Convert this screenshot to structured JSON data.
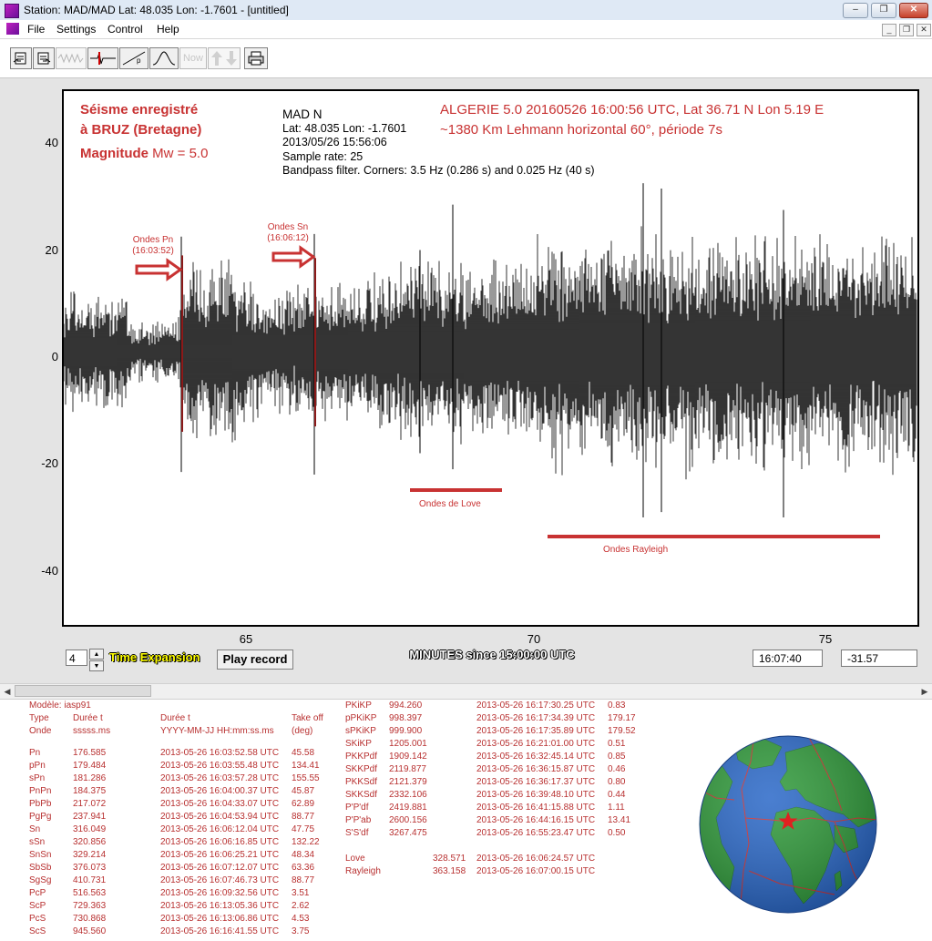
{
  "window": {
    "title": "Station: MAD/MAD Lat: 48.035 Lon: -1.7601 - [untitled]",
    "controls": [
      "–",
      "❐",
      "✕"
    ]
  },
  "menu": [
    "File",
    "Settings",
    "Control",
    "Help"
  ],
  "toolbar": {
    "icons": [
      "open-file-icon",
      "save-file-icon",
      "raw-trace-icon",
      "filter-trace-icon",
      "spectrum-icon",
      "distribution-icon",
      "now-icon",
      "up-down-arrows-icon",
      "print-icon"
    ],
    "now_label": "Now"
  },
  "plot": {
    "annotation_left": {
      "line1": "Séisme enregistré",
      "line2": "à BRUZ (Bretagne)",
      "line3_a": "Magnitude",
      "line3_b": "Mw = 5.0"
    },
    "info_block": {
      "station": "MAD  N",
      "latlon": "Lat: 48.035 Lon: -1.7601",
      "datetime": "2013/05/26 15:56:06",
      "sample_rate": "Sample rate: 25",
      "filter": "Bandpass filter. Corners: 3.5 Hz (0.286 s) and 0.025 Hz (40 s)"
    },
    "annotation_right": {
      "line1": "ALGERIE 5.0 20160526 16:00:56 UTC, Lat 36.71 N Lon 5.19 E",
      "line2": "~1380 Km Lehmann horizontal 60°, période 7s"
    },
    "markers": {
      "pn_label": "Ondes Pn",
      "pn_time": "(16:03:52)",
      "sn_label": "Ondes Sn",
      "sn_time": "(16:06:12)",
      "love_label": "Ondes de Love",
      "rayleigh_label": "Ondes Rayleigh"
    },
    "y_ticks": [
      "40",
      "20",
      "0",
      "-20",
      "-40"
    ],
    "x_ticks": [
      "65",
      "70",
      "75"
    ],
    "x_axis_title": "MINUTES since 15:00:00 UTC",
    "colors": {
      "trace": "#000000",
      "annotation_red": "#c83232",
      "pick_line": "#8b1a1a"
    }
  },
  "controls": {
    "time_expansion_value": "4",
    "time_expansion_label": "Time Expansion",
    "play_button": "Play record",
    "time_readout": "16:07:40",
    "value_readout": "-31.57"
  },
  "phases_left": {
    "model": "Modèle: iasp91",
    "header1": [
      "Type",
      "Durée t",
      "Durée t",
      "Take off"
    ],
    "header2": [
      "Onde",
      "sssss.ms",
      "YYYY-MM-JJ HH:mm:ss.ms",
      "(deg)"
    ],
    "rows": [
      [
        "Pn",
        "176.585",
        "2013-05-26 16:03:52.58 UTC",
        "45.58"
      ],
      [
        "pPn",
        "179.484",
        "2013-05-26 16:03:55.48 UTC",
        "134.41"
      ],
      [
        "sPn",
        "181.286",
        "2013-05-26 16:03:57.28 UTC",
        "155.55"
      ],
      [
        "PnPn",
        "184.375",
        "2013-05-26 16:04:00.37 UTC",
        "45.87"
      ],
      [
        "PbPb",
        "217.072",
        "2013-05-26 16:04:33.07 UTC",
        "62.89"
      ],
      [
        "PgPg",
        "237.941",
        "2013-05-26 16:04:53.94 UTC",
        "88.77"
      ],
      [
        "Sn",
        "316.049",
        "2013-05-26 16:06:12.04 UTC",
        "47.75"
      ],
      [
        "sSn",
        "320.856",
        "2013-05-26 16:06:16.85 UTC",
        "132.22"
      ],
      [
        "SnSn",
        "329.214",
        "2013-05-26 16:06:25.21 UTC",
        "48.34"
      ],
      [
        "SbSb",
        "376.073",
        "2013-05-26 16:07:12.07 UTC",
        "63.36"
      ],
      [
        "SgSg",
        "410.731",
        "2013-05-26 16:07:46.73 UTC",
        "88.77"
      ],
      [
        "PcP",
        "516.563",
        "2013-05-26 16:09:32.56 UTC",
        "3.51"
      ],
      [
        "ScP",
        "729.363",
        "2013-05-26 16:13:05.36 UTC",
        "2.62"
      ],
      [
        "PcS",
        "730.868",
        "2013-05-26 16:13:06.86 UTC",
        "4.53"
      ],
      [
        "ScS",
        "945.560",
        "2013-05-26 16:16:41.55 UTC",
        "3.75"
      ]
    ]
  },
  "phases_right": {
    "rows": [
      [
        "PKiKP",
        "994.260",
        "2013-05-26 16:17:30.25 UTC",
        "0.83"
      ],
      [
        "pPKiKP",
        "998.397",
        "2013-05-26 16:17:34.39 UTC",
        "179.17"
      ],
      [
        "sPKiKP",
        "999.900",
        "2013-05-26 16:17:35.89 UTC",
        "179.52"
      ],
      [
        "SKiKP",
        "1205.001",
        "2013-05-26 16:21:01.00 UTC",
        "0.51"
      ],
      [
        "PKKPdf",
        "1909.142",
        "2013-05-26 16:32:45.14 UTC",
        "0.85"
      ],
      [
        "SKKPdf",
        "2119.877",
        "2013-05-26 16:36:15.87 UTC",
        "0.46"
      ],
      [
        "PKKSdf",
        "2121.379",
        "2013-05-26 16:36:17.37 UTC",
        "0.80"
      ],
      [
        "SKKSdf",
        "2332.106",
        "2013-05-26 16:39:48.10 UTC",
        "0.44"
      ],
      [
        "P'P'df",
        "2419.881",
        "2013-05-26 16:41:15.88 UTC",
        "1.11"
      ],
      [
        "P'P'ab",
        "2600.156",
        "2013-05-26 16:44:16.15 UTC",
        "13.41"
      ],
      [
        "S'S'df",
        "3267.475",
        "2013-05-26 16:55:23.47 UTC",
        "0.50"
      ]
    ],
    "surface": [
      [
        "Love",
        "328.571",
        "2013-05-26 16:06:24.57 UTC"
      ],
      [
        "Rayleigh",
        "363.158",
        "2013-05-26 16:07:00.15 UTC"
      ]
    ]
  },
  "globe": {
    "ocean": "#2a68c8",
    "land": "#2f9a3a",
    "plates": "#d23030",
    "marker": "#e02020"
  }
}
